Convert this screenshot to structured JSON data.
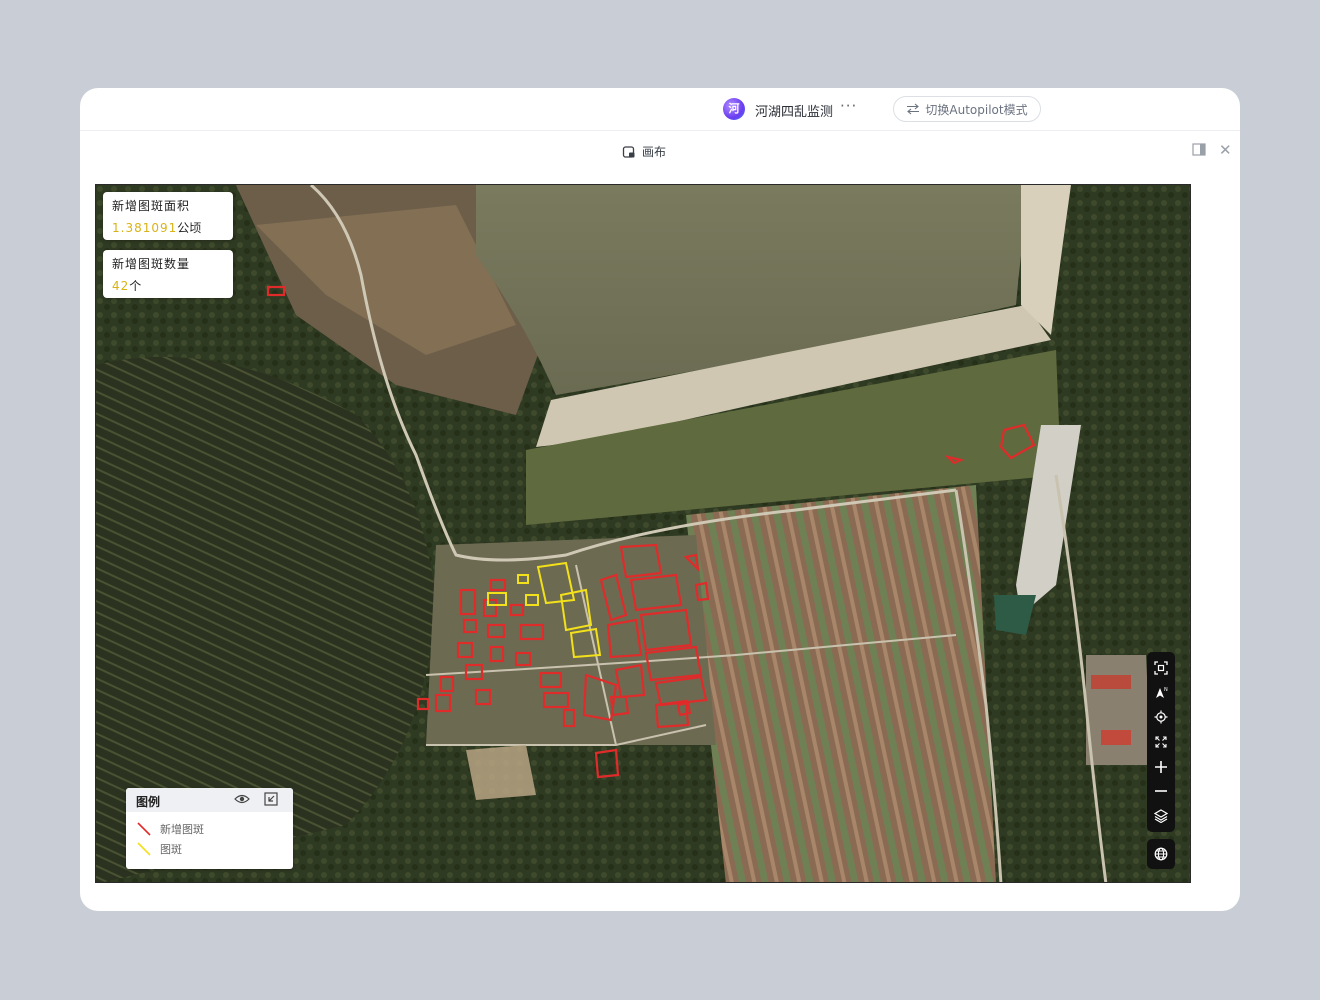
{
  "app": {
    "badge": "河",
    "title": "河湖四乱监测",
    "more": "···",
    "autopilot_label": "切换Autopilot模式"
  },
  "canvas": {
    "title": "画布"
  },
  "stats": {
    "area_label": "新增图斑面积",
    "area_value": "1.381091",
    "area_unit": "公顷",
    "count_label": "新增图斑数量",
    "count_value": "42",
    "count_unit": "个"
  },
  "legend": {
    "title": "图例",
    "items": [
      {
        "label": "新增图斑",
        "color": "#e02b2b"
      },
      {
        "label": "图斑",
        "color": "#f2e01a"
      }
    ]
  },
  "map_tools": [
    "fit-extent-icon",
    "north-arrow-icon",
    "locate-icon",
    "fullscreen-icon",
    "zoom-in-icon",
    "zoom-out-icon",
    "layers-icon",
    "globe-icon"
  ],
  "colors": {
    "new_patch": "#e02b2b",
    "patch": "#f2e01a",
    "value_highlight": "#d8b318"
  }
}
